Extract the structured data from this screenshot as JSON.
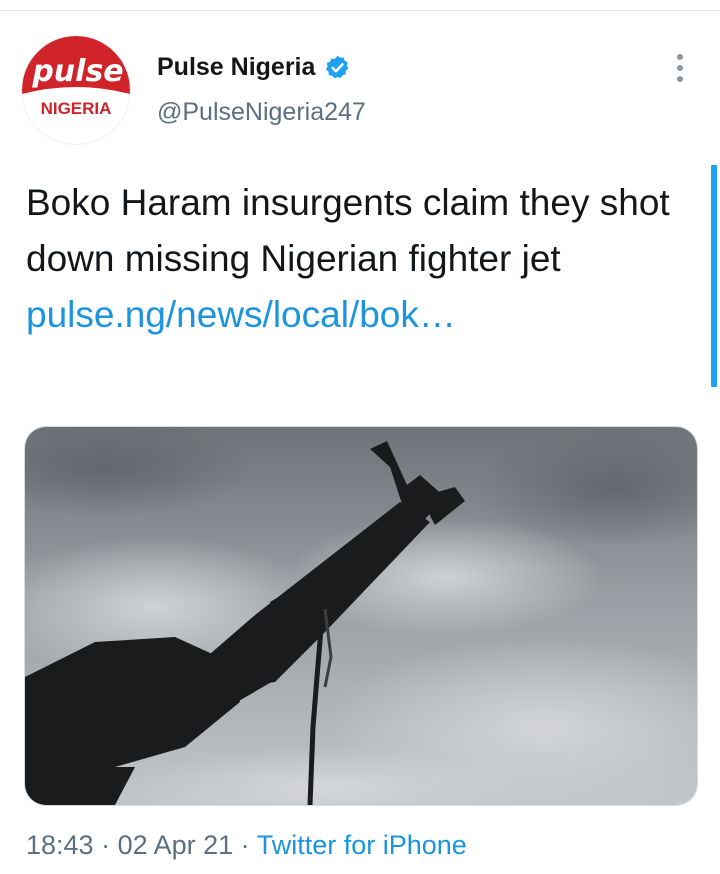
{
  "profile": {
    "avatar_top": "pulse",
    "avatar_bottom": "NIGERIA",
    "display_name": "Pulse Nigeria",
    "handle": "@PulseNigeria247",
    "verified_icon": "verified-badge-icon"
  },
  "tweet": {
    "text": "Boko Haram insurgents claim they shot down missing Nigerian fighter jet ",
    "link_text": "pulse.ng/news/local/bok…",
    "media_alt": "silhouette of a raised rifle against a cloudy sky"
  },
  "meta": {
    "time": "18:43",
    "date": "02 Apr 21",
    "source": "Twitter for iPhone",
    "separator": " · "
  },
  "colors": {
    "link": "#1b95e0",
    "secondary_text": "#5b7083",
    "brand_red": "#d0242a",
    "verified": "#1da1f2"
  }
}
